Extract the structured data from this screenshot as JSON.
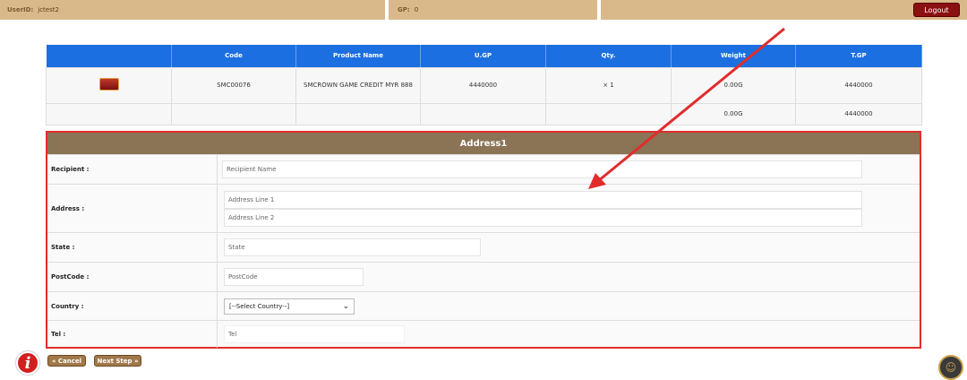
{
  "topbar": {
    "userid_label": "UserID:",
    "userid_value": "jctest2",
    "gp_label": "GP:",
    "gp_value": "0",
    "logout_label": "Logout"
  },
  "cart": {
    "headers": [
      "",
      "Code",
      "Product Name",
      "U.GP",
      "Qty.",
      "Weight",
      "T.GP"
    ],
    "item": {
      "code": "SMC00076",
      "product_name": "SMCROWN GAME CREDIT MYR 888",
      "ugp": "4440000",
      "qty": "× 1",
      "weight": "0.00G",
      "tgp": "4440000"
    },
    "total": {
      "weight": "0.00G",
      "tgp": "4440000"
    }
  },
  "address": {
    "title": "Address1",
    "recipient_label": "Recipient :",
    "recipient_placeholder": "Recipient Name",
    "address_label": "Address :",
    "address_line1_placeholder": "Address Line 1",
    "address_line2_placeholder": "Address Line 2",
    "state_label": "State :",
    "state_placeholder": "State",
    "postcode_label": "PostCode :",
    "postcode_placeholder": "PostCode",
    "country_label": "Country :",
    "country_selected": "[--Select Country--]",
    "tel_label": "Tel :",
    "tel_placeholder": "Tel"
  },
  "actions": {
    "cancel_label": "« Cancel",
    "next_label": "Next Step »"
  },
  "icons": {
    "info": "info-icon",
    "chat": "support-chat-icon"
  },
  "colors": {
    "accent_blue": "#1c6fe0",
    "header_brown": "#8b7355",
    "highlight_red": "#e22c2c",
    "logout_red": "#8b1010"
  }
}
